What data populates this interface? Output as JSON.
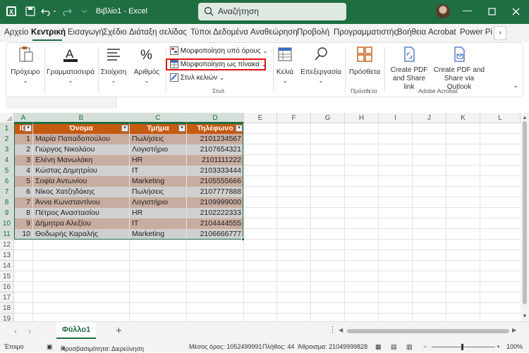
{
  "titlebar": {
    "app_title": "Βιβλίο1 - Excel",
    "search_placeholder": "Αναζήτηση"
  },
  "tabs": [
    "Αρχείο",
    "Κεντρική",
    "Εισαγωγή",
    "Σχέδιο",
    "Διάταξη σελίδας",
    "Τύποι",
    "Δεδομένα",
    "Αναθεώρηση",
    "Προβολή",
    "Προγραμματιστής",
    "Βοήθεια",
    "Acrobat",
    "Power Pivot"
  ],
  "active_tab": "Κεντρική",
  "ribbon": {
    "clipboard": "Πρόχειρο",
    "font": "Γραμματοσειρά",
    "alignment": "Στοίχιση",
    "number": "Αριθμός",
    "cond_format": "Μορφοποίηση υπό όρους",
    "format_table": "Μορφοποίηση ως πίνακα",
    "cell_styles": "Στυλ κελιών",
    "styles_group": "Στυλ",
    "cells": "Κελιά",
    "editing": "Επεξεργασία",
    "addins": "Πρόσθετα",
    "addins_group": "Πρόσθετα",
    "pdf_share": "Create PDF and Share link",
    "pdf_outlook": "Create PDF and Share via Outlook",
    "adobe_group": "Adobe Acrobat"
  },
  "columns": [
    "A",
    "B",
    "C",
    "D",
    "E",
    "F",
    "G",
    "H",
    "I",
    "J",
    "K",
    "L"
  ],
  "rows": [
    "1",
    "2",
    "3",
    "4",
    "5",
    "6",
    "7",
    "8",
    "9",
    "10",
    "11",
    "12",
    "13",
    "14",
    "15",
    "16",
    "17",
    "18",
    "19"
  ],
  "table": {
    "headers": [
      "ID",
      "Όνομα",
      "Τμήμα",
      "Τηλέφωνο"
    ],
    "rows": [
      [
        "1",
        "Μαρία Παπαδοπούλου",
        "Πωλήσεις",
        "2101234567"
      ],
      [
        "2",
        "Γιώργος Νικολάου",
        "Λογιστήριο",
        "2107654321"
      ],
      [
        "3",
        "Ελένη Μανωλάκη",
        "HR",
        "2101111222"
      ],
      [
        "4",
        "Κώστας Δημητρίου",
        "IT",
        "2103333444"
      ],
      [
        "5",
        "Σοφία Αντωνίου",
        "Marketing",
        "2105555666"
      ],
      [
        "6",
        "Νίκος Χατζηδάκης",
        "Πωλήσεις",
        "2107777888"
      ],
      [
        "7",
        "Άννα Κωνσταντίνου",
        "Λογιστήριο",
        "2109999000"
      ],
      [
        "8",
        "Πέτρος Αναστασίου",
        "HR",
        "2102222333"
      ],
      [
        "9",
        "Δήμητρα Αλεξίου",
        "IT",
        "2104444555"
      ],
      [
        "10",
        "Θοδωρής Καραλής",
        "Marketing",
        "2106666777"
      ]
    ]
  },
  "sheet_tab": "Φύλλο1",
  "status": {
    "ready": "Έτοιμο",
    "accessibility": "Προσβασιμότητα: Διερεύνηση",
    "average": "Μέσος όρος: 1052499991",
    "count": "Πλήθος: 44",
    "sum": "Άθροισμα: 21049999828",
    "zoom": "100%"
  }
}
